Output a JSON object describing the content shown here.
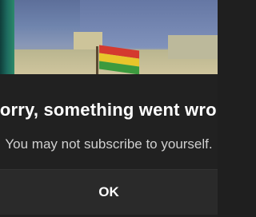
{
  "dialog": {
    "title": "Sorry, something went wrong",
    "message": "You may not subscribe to yourself.",
    "ok_label": "OK"
  },
  "colors": {
    "dialog_background": "#212121",
    "title_text": "#ffffff",
    "message_text": "#d0d0d0",
    "button_bar": "#2a2a2a"
  }
}
